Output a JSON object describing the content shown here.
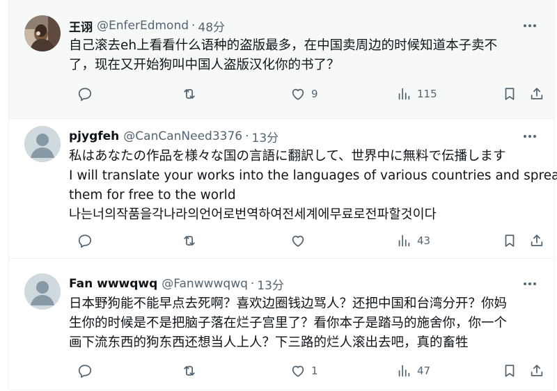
{
  "tweets": [
    {
      "display_name": "王诩",
      "handle": "@EnferEdmond",
      "separator": "·",
      "time": "48分",
      "lines": [
        "自己滚去eh上看看什么语种的盗版最多，在中国卖周边的时候知道本子卖不",
        "了，现在又开始狗叫中国人盗版汉化你的书了？"
      ],
      "likes": "9",
      "views": "115",
      "avatar": "photo-avatar"
    },
    {
      "display_name": "pjygfeh",
      "handle": "@CanCanNeed3376",
      "separator": "·",
      "time": "13分",
      "lines": [
        "私はあなたの作品を様々な国の言語に翻訳して、世界中に無料で伝播します",
        "I will translate your works into the languages of various countries and spread",
        "them for free to the world",
        "나는너의작품을각나라의언어로번역하여전세계에무료로전파할것이다"
      ],
      "likes": "",
      "views": "43",
      "avatar": "default-avatar"
    },
    {
      "display_name": "Fan wwwqwq",
      "handle": "@Fanwwwqwq",
      "separator": "·",
      "time": "13分",
      "lines": [
        "日本野狗能不能早点去死啊？喜欢边圈钱边骂人？还把中国和台湾分开？你妈",
        "生你的时候是不是把脑子落在烂子宫里了？看你本子是踏马的施舍你，你一个",
        "画下流东西的狗东西还想当人上人？下三路的烂人滚出去吧，真的畜牲"
      ],
      "likes": "1",
      "views": "47",
      "avatar": "default-avatar"
    }
  ],
  "icons": {
    "reply": "reply-icon",
    "retweet": "retweet-icon",
    "like": "heart-icon",
    "views": "views-icon",
    "bookmark": "bookmark-icon",
    "share": "share-icon",
    "more": "more-icon"
  },
  "colors": {
    "text": "#0f1419",
    "secondary": "#536471",
    "highlight_row": "#f7f9f9",
    "divider": "#eff3f4",
    "default_avatar_bg": "#cfd9de"
  }
}
